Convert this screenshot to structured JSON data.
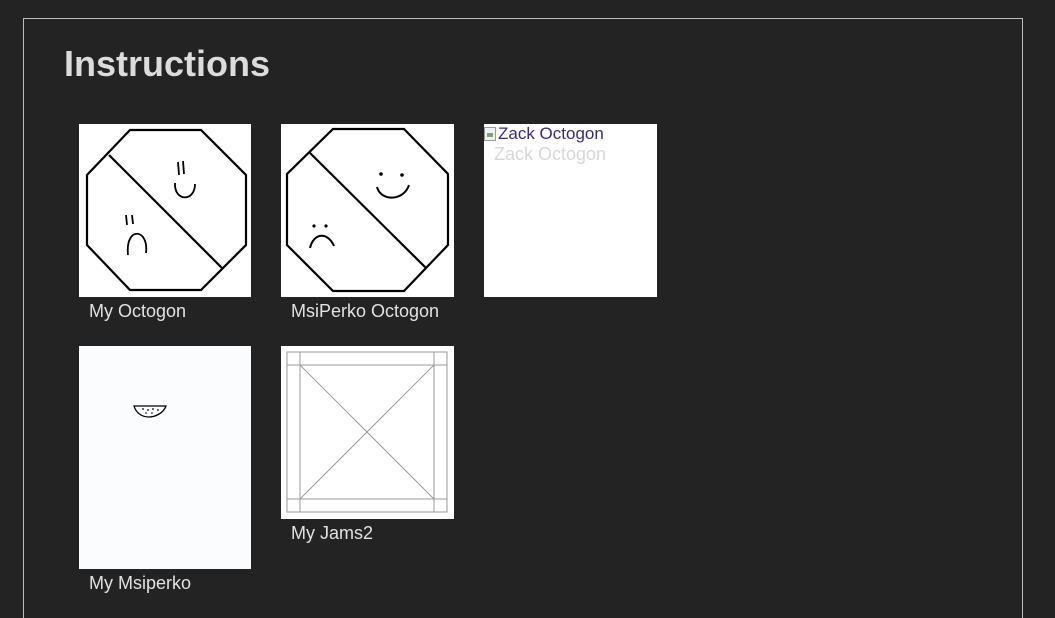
{
  "page": {
    "title": "Instructions"
  },
  "gallery": {
    "items": [
      {
        "id": "my-octogon",
        "caption": "My Octogon",
        "image": "octagon-split-face-sketch"
      },
      {
        "id": "msiperko-octogon",
        "caption": "MsiPerko Octogon",
        "image": "octagon-split-face-clean"
      },
      {
        "id": "zack-octogon",
        "caption": "Zack Octogon",
        "image": "broken-image-icon",
        "alt": "Zack Octogon",
        "broken_label": "Zack Octogon"
      },
      {
        "id": "my-msiperko",
        "caption": "My Msiperko",
        "image": "watermelon-slice-drawing"
      },
      {
        "id": "my-jams2",
        "caption": "My Jams2",
        "image": "x-frame-sketch"
      }
    ]
  },
  "colors": {
    "background": "#232323",
    "panel_border": "#bdbdbd",
    "text": "#e2e2e2",
    "broken_link": "#3d2a77"
  }
}
